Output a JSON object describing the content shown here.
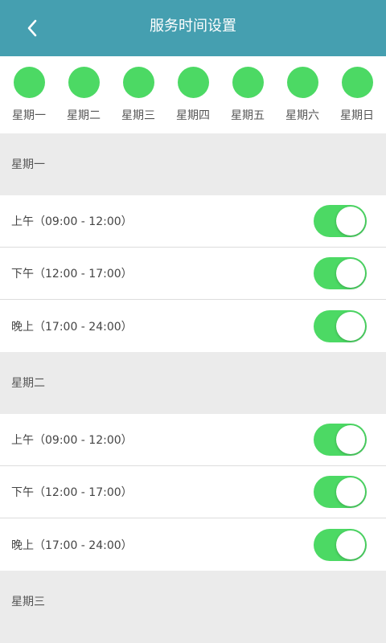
{
  "header": {
    "title": "服务时间设置",
    "back_icon": "chevron-left-icon",
    "background_color": "#459fb0"
  },
  "accent_color": "#4cd964",
  "weekdays": [
    {
      "label": "星期一",
      "selected": true
    },
    {
      "label": "星期二",
      "selected": true
    },
    {
      "label": "星期三",
      "selected": true
    },
    {
      "label": "星期四",
      "selected": true
    },
    {
      "label": "星期五",
      "selected": true
    },
    {
      "label": "星期六",
      "selected": true
    },
    {
      "label": "星期日",
      "selected": true
    }
  ],
  "sections": [
    {
      "day": "星期一",
      "slots": [
        {
          "label": "上午（09:00 - 12:00）",
          "enabled": true
        },
        {
          "label": "下午（12:00 - 17:00）",
          "enabled": true
        },
        {
          "label": "晚上（17:00 - 24:00）",
          "enabled": true
        }
      ]
    },
    {
      "day": "星期二",
      "slots": [
        {
          "label": "上午（09:00 - 12:00）",
          "enabled": true
        },
        {
          "label": "下午（12:00 - 17:00）",
          "enabled": true
        },
        {
          "label": "晚上（17:00 - 24:00）",
          "enabled": true
        }
      ]
    },
    {
      "day": "星期三",
      "slots": []
    }
  ]
}
